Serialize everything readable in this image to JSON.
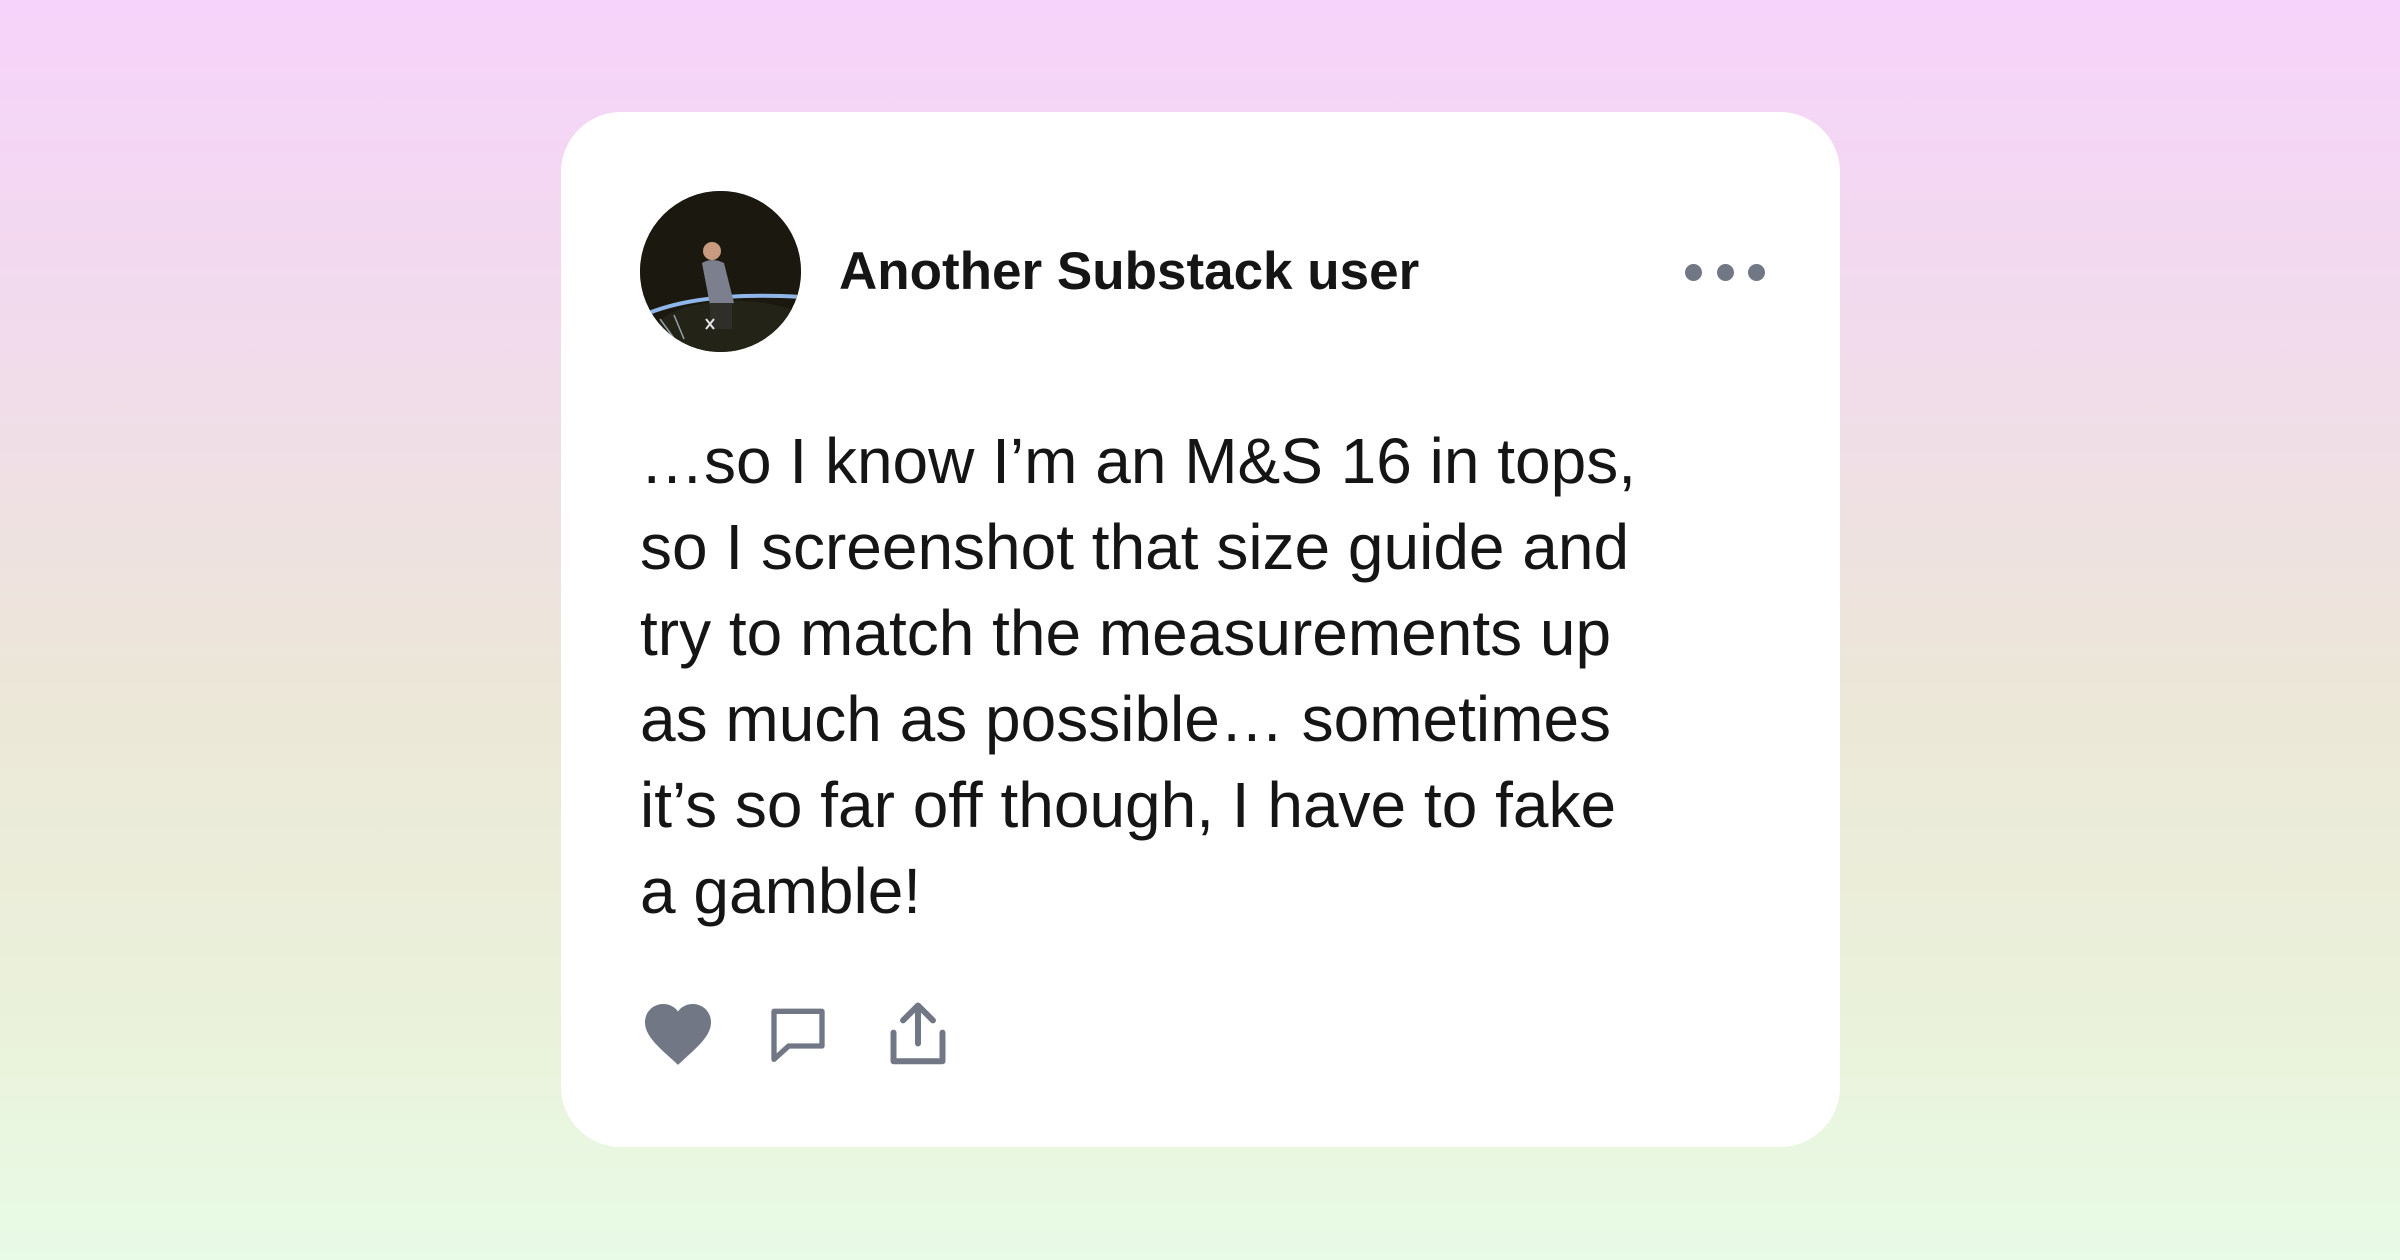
{
  "post": {
    "author": "Another Substack user",
    "text": "…so I know I’m an M&S 16 in tops,\nso I screenshot that size guide and\ntry to match the measurements up\nas much as possible… sometimes\nit’s so far off though, I have to fake\na gamble!"
  },
  "actions": {
    "like_icon": "heart-icon",
    "comment_icon": "comment-bubble-icon",
    "share_icon": "share-icon"
  },
  "menu_icon": "more-options-icon",
  "colors": {
    "icon_gray": "#727786",
    "text": "#151515",
    "card_bg": "#ffffff"
  }
}
